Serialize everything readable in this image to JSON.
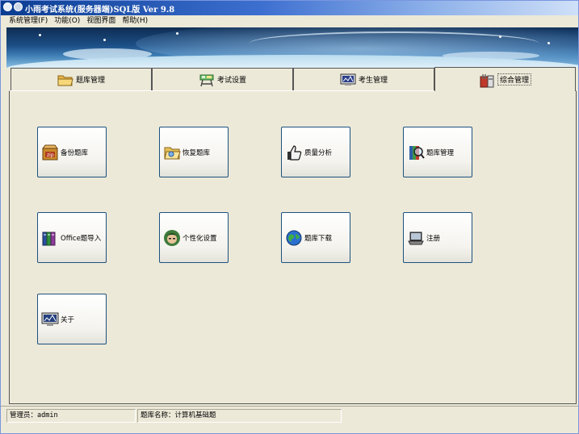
{
  "window": {
    "title": "小雨考试系统(服务器端)SQL版 Ver 9.8"
  },
  "menu": [
    {
      "label": "系统管理(F)"
    },
    {
      "label": "功能(O)"
    },
    {
      "label": "视图界面"
    },
    {
      "label": "帮助(H)"
    }
  ],
  "tabs": [
    {
      "label": "题库管理",
      "icon": "folder-icon"
    },
    {
      "label": "考试设置",
      "icon": "desk-icon"
    },
    {
      "label": "考生管理",
      "icon": "monitor-icon"
    },
    {
      "label": "综合管理",
      "icon": "toolkit-icon",
      "active": true
    }
  ],
  "buttons": [
    {
      "label": "备份题库",
      "icon": "zip-box-icon"
    },
    {
      "label": "恢复题库",
      "icon": "open-folder-icon"
    },
    {
      "label": "质量分析",
      "icon": "thumbs-up-icon"
    },
    {
      "label": "题库管理",
      "icon": "books-magnifier-icon"
    },
    {
      "label": "Office题导入",
      "icon": "office-books-icon"
    },
    {
      "label": "个性化设置",
      "icon": "avatar-icon"
    },
    {
      "label": "题库下载",
      "icon": "globe-icon"
    },
    {
      "label": "注册",
      "icon": "laptop-icon"
    },
    {
      "label": "关于",
      "icon": "monitor-chart-icon"
    }
  ],
  "status": {
    "admin": "管理员：admin",
    "bank": "题库名称：计算机基础题"
  }
}
